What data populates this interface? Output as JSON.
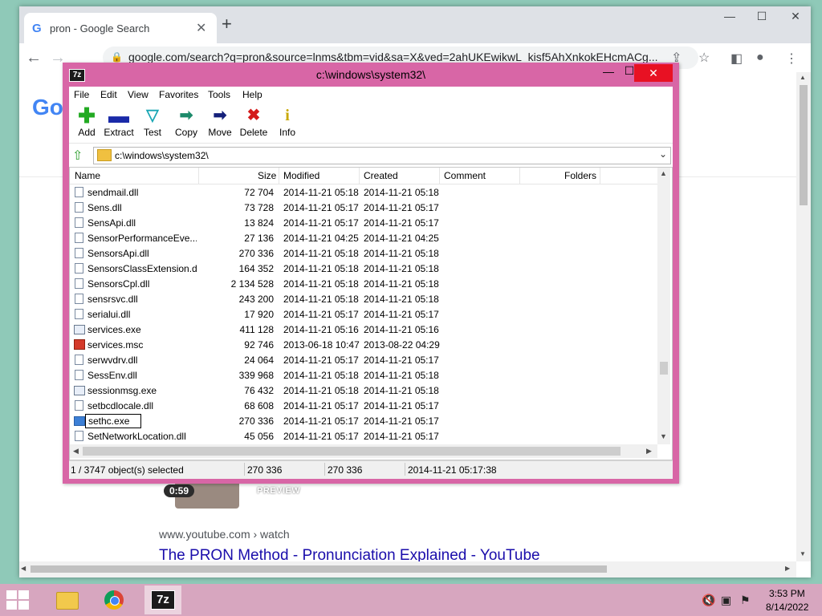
{
  "browser": {
    "tab_title": "pron - Google Search",
    "tab_favicon": "G",
    "url": "google.com/search?q=pron&source=lnms&tbm=vid&sa=X&ved=2ahUKEwikwL_kisf5AhXnkokEHcmACg...",
    "logo_text": "Go",
    "video_duration": "0:59",
    "video_preview_label": "PREVIEW",
    "result_cite": "www.youtube.com › watch",
    "result_title": "The PRON Method - Pronunciation Explained - YouTube"
  },
  "sevenzip": {
    "title": "c:\\windows\\system32\\",
    "icon_label": "7z",
    "menu": [
      "File",
      "Edit",
      "View",
      "Favorites",
      "Tools",
      "Help"
    ],
    "toolbar": [
      {
        "label": "Add",
        "icon": "plus-icon",
        "color": "#22aa22"
      },
      {
        "label": "Extract",
        "icon": "minus-icon",
        "color": "#1a2aa8"
      },
      {
        "label": "Test",
        "icon": "check-icon",
        "color": "#19a6b4"
      },
      {
        "label": "Copy",
        "icon": "arrow-double-icon",
        "color": "#1c8a6a"
      },
      {
        "label": "Move",
        "icon": "arrow-right-icon",
        "color": "#14207a"
      },
      {
        "label": "Delete",
        "icon": "x-icon",
        "color": "#d41a1a"
      },
      {
        "label": "Info",
        "icon": "info-icon",
        "color": "#c8a800"
      }
    ],
    "address": "c:\\windows\\system32\\",
    "columns": {
      "name": "Name",
      "size": "Size",
      "modified": "Modified",
      "created": "Created",
      "comment": "Comment",
      "folders": "Folders"
    },
    "rows": [
      {
        "name": "sendmail.dll",
        "size": "72 704",
        "modified": "2014-11-21 05:18",
        "created": "2014-11-21 05:18",
        "type": "dll"
      },
      {
        "name": "Sens.dll",
        "size": "73 728",
        "modified": "2014-11-21 05:17",
        "created": "2014-11-21 05:17",
        "type": "dll"
      },
      {
        "name": "SensApi.dll",
        "size": "13 824",
        "modified": "2014-11-21 05:17",
        "created": "2014-11-21 05:17",
        "type": "dll"
      },
      {
        "name": "SensorPerformanceEve...",
        "size": "27 136",
        "modified": "2014-11-21 04:25",
        "created": "2014-11-21 04:25",
        "type": "dll"
      },
      {
        "name": "SensorsApi.dll",
        "size": "270 336",
        "modified": "2014-11-21 05:18",
        "created": "2014-11-21 05:18",
        "type": "dll"
      },
      {
        "name": "SensorsClassExtension.dll",
        "size": "164 352",
        "modified": "2014-11-21 05:18",
        "created": "2014-11-21 05:18",
        "type": "dll"
      },
      {
        "name": "SensorsCpl.dll",
        "size": "2 134 528",
        "modified": "2014-11-21 05:18",
        "created": "2014-11-21 05:18",
        "type": "dll"
      },
      {
        "name": "sensrsvc.dll",
        "size": "243 200",
        "modified": "2014-11-21 05:18",
        "created": "2014-11-21 05:18",
        "type": "dll"
      },
      {
        "name": "serialui.dll",
        "size": "17 920",
        "modified": "2014-11-21 05:17",
        "created": "2014-11-21 05:17",
        "type": "dll"
      },
      {
        "name": "services.exe",
        "size": "411 128",
        "modified": "2014-11-21 05:16",
        "created": "2014-11-21 05:16",
        "type": "exe"
      },
      {
        "name": "services.msc",
        "size": "92 746",
        "modified": "2013-06-18 10:47",
        "created": "2013-08-22 04:29",
        "type": "msc"
      },
      {
        "name": "serwvdrv.dll",
        "size": "24 064",
        "modified": "2014-11-21 05:17",
        "created": "2014-11-21 05:17",
        "type": "dll"
      },
      {
        "name": "SessEnv.dll",
        "size": "339 968",
        "modified": "2014-11-21 05:18",
        "created": "2014-11-21 05:18",
        "type": "dll"
      },
      {
        "name": "sessionmsg.exe",
        "size": "76 432",
        "modified": "2014-11-21 05:18",
        "created": "2014-11-21 05:18",
        "type": "exe"
      },
      {
        "name": "setbcdlocale.dll",
        "size": "68 608",
        "modified": "2014-11-21 05:17",
        "created": "2014-11-21 05:17",
        "type": "dll"
      },
      {
        "name": "sethc.exe",
        "size": "270 336",
        "modified": "2014-11-21 05:17",
        "created": "2014-11-21 05:17",
        "type": "exe",
        "selected": true
      },
      {
        "name": "SetNetworkLocation.dll",
        "size": "45 056",
        "modified": "2014-11-21 05:17",
        "created": "2014-11-21 05:17",
        "type": "dll"
      }
    ],
    "status": {
      "selection": "1 / 3747 object(s) selected",
      "size": "270 336",
      "packed": "270 336",
      "modified": "2014-11-21 05:17:38"
    }
  },
  "taskbar": {
    "sevenzip_label": "7z",
    "time": "3:53 PM",
    "date": "8/14/2022"
  }
}
